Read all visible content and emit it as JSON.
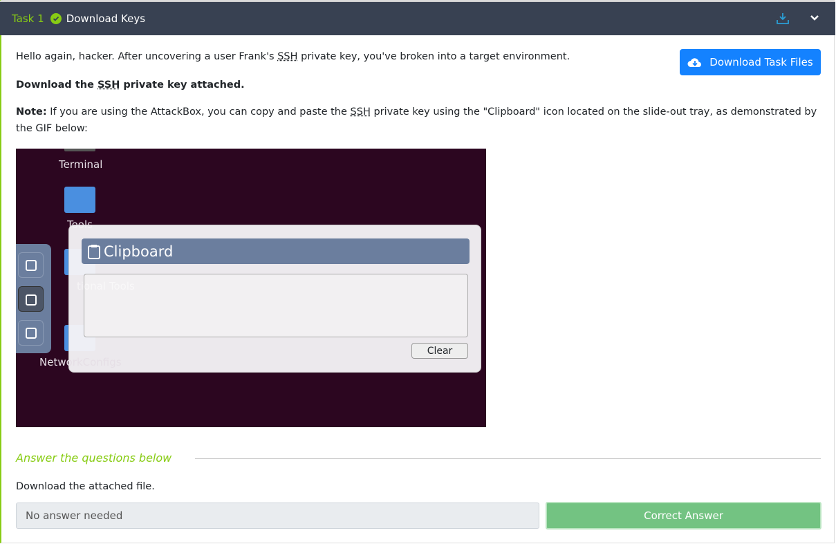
{
  "task": {
    "number": "Task 1",
    "title": "Download Keys",
    "completed": true
  },
  "colors": {
    "accent": "#88cc14",
    "header_bg": "#384152",
    "primary": "#1482ff",
    "success": "#73c382"
  },
  "download_button": "Download Task Files",
  "intro": {
    "a": "Hello again, hacker. After uncovering a user Frank's ",
    "abbr": "SSH",
    "b": " private key, you've broken into a target environment."
  },
  "bold": {
    "a": "Download the ",
    "abbr": "SSH",
    "b": " private key attached."
  },
  "note": {
    "label": "Note:",
    "a": " If you are using the AttackBox, you can copy and paste the ",
    "abbr": "SSH",
    "b": " private key using the \"Clipboard\" icon located on the slide-out tray, as demonstrated by the GIF below:"
  },
  "gif": {
    "terminal": "Terminal",
    "tools": "Tools",
    "additional": "tional Tools",
    "network": "NetworkConfigs",
    "clipboard_title": "Clipboard",
    "clear": "Clear"
  },
  "answers": {
    "heading": "Answer the questions below",
    "question": "Download the attached file.",
    "placeholder": "No answer needed",
    "submit": "Correct Answer"
  }
}
